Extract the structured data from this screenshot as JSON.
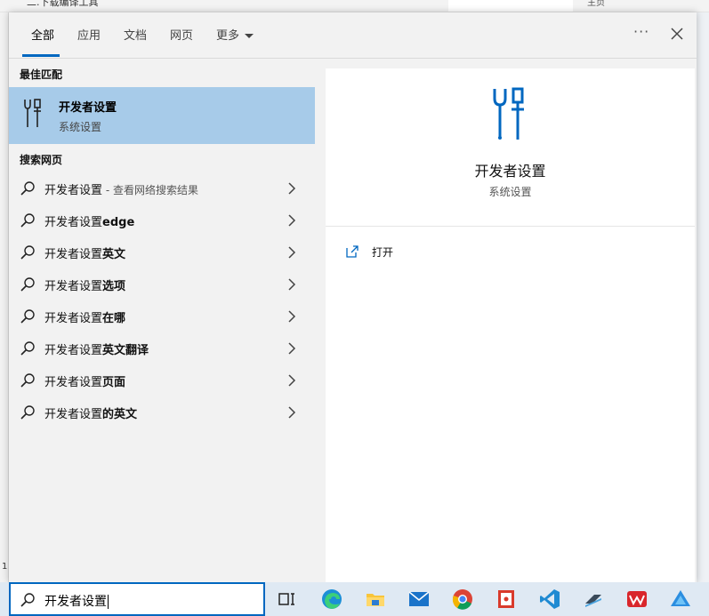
{
  "background": {
    "left_text": "二.下载编译工具",
    "right_text": "主页",
    "edge_num": "1"
  },
  "tabs": [
    {
      "label": "全部",
      "active": true
    },
    {
      "label": "应用"
    },
    {
      "label": "文档"
    },
    {
      "label": "网页"
    },
    {
      "label": "更多"
    }
  ],
  "header": {
    "more_options": "···"
  },
  "best_match": {
    "section_title": "最佳匹配",
    "title": "开发者设置",
    "subtitle": "系统设置",
    "icon": "developer-settings-icon"
  },
  "web": {
    "section_title": "搜索网页",
    "results": [
      {
        "prefix": "开发者设置",
        "bold": "",
        "hint": " - 查看网络搜索结果"
      },
      {
        "prefix": "开发者设置",
        "bold": "edge",
        "hint": ""
      },
      {
        "prefix": "开发者设置",
        "bold": "英文",
        "hint": ""
      },
      {
        "prefix": "开发者设置",
        "bold": "选项",
        "hint": ""
      },
      {
        "prefix": "开发者设置",
        "bold": "在哪",
        "hint": ""
      },
      {
        "prefix": "开发者设置",
        "bold": "英文翻译",
        "hint": ""
      },
      {
        "prefix": "开发者设置",
        "bold": "页面",
        "hint": ""
      },
      {
        "prefix": "开发者设置",
        "bold": "的英文",
        "hint": ""
      }
    ]
  },
  "preview": {
    "title": "开发者设置",
    "subtitle": "系统设置",
    "open_label": "打开"
  },
  "taskbar": {
    "search_value": "开发者设置",
    "apps": [
      "task-view-icon",
      "edge-icon",
      "file-explorer-icon",
      "mail-icon",
      "chrome-icon",
      "app-icon",
      "vscode-icon",
      "terminal-app-icon",
      "wps-icon",
      "cloud-drive-icon"
    ]
  },
  "colors": {
    "accent": "#0067c0",
    "selected_bg": "#a7cbe9",
    "flyout_bg": "#f2f2f2",
    "taskbar_bg": "#dfe9f3"
  }
}
